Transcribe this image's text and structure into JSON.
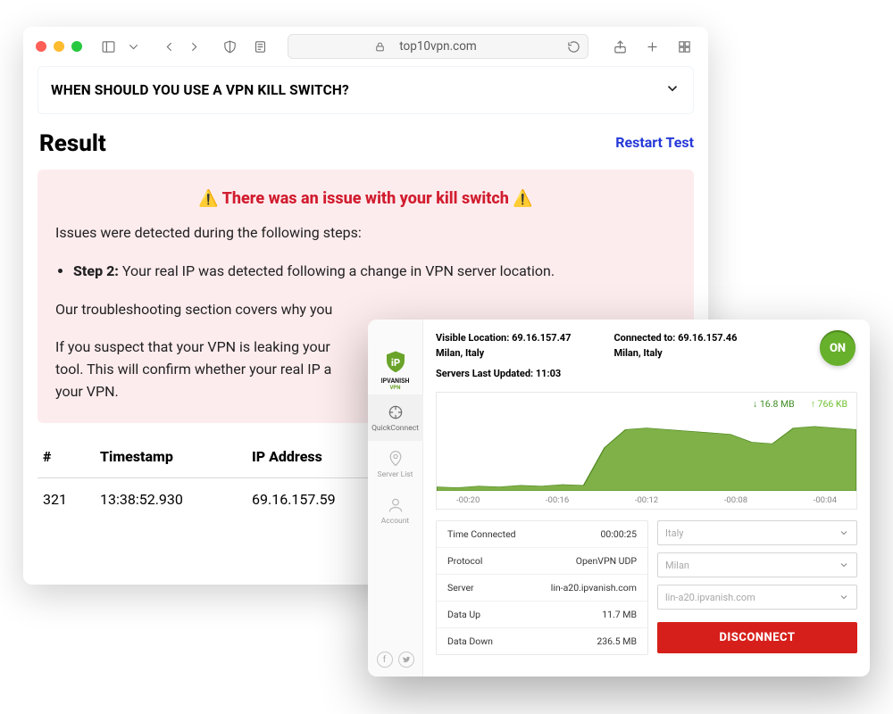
{
  "browser": {
    "domain": "top10vpn.com",
    "accordion_title": "WHEN SHOULD YOU USE A VPN KILL SWITCH?",
    "result_heading": "Result",
    "restart_label": "Restart Test",
    "alert_title_core": "There was an issue with your kill switch",
    "issues_intro": "Issues were detected during the following steps:",
    "step_label": "Step 2:",
    "step_text": "Your real IP was detected following a change in VPN server location.",
    "troubleshoot_trunc": "Our troubleshooting section covers why you",
    "leak_para_trunc": "If you suspect that your VPN is leaking your \ntool. This will confirm whether your real IP a\nyour VPN.",
    "table": {
      "headers": [
        "#",
        "Timestamp",
        "IP Address"
      ],
      "row": [
        "321",
        "13:38:52.930",
        "69.16.157.59"
      ]
    }
  },
  "app": {
    "brand": "IPVANISH",
    "brand_sub": "VPN",
    "nav": {
      "quickconnect": "QuickConnect",
      "serverlist": "Server List",
      "account": "Account"
    },
    "visible_location_label": "Visible Location:",
    "visible_location_ip": "69.16.157.47",
    "visible_location_city": "Milan, Italy",
    "servers_updated_label": "Servers Last Updated:",
    "servers_updated_time": "11:03",
    "connected_to_label": "Connected to:",
    "connected_to_ip": "69.16.157.46",
    "connected_to_city": "Milan, Italy",
    "on_label": "ON",
    "down_rate": "16.8 MB",
    "up_rate": "766 KB",
    "axis": [
      "-00:20",
      "-00:16",
      "-00:12",
      "-00:08",
      "-00:04"
    ],
    "stats": {
      "time_connected_label": "Time Connected",
      "time_connected": "00:00:25",
      "protocol_label": "Protocol",
      "protocol": "OpenVPN UDP",
      "server_label": "Server",
      "server": "lin-a20.ipvanish.com",
      "data_up_label": "Data Up",
      "data_up": "11.7 MB",
      "data_down_label": "Data Down",
      "data_down": "236.5 MB"
    },
    "dd_country": "Italy",
    "dd_city": "Milan",
    "dd_server": "lin-a20.ipvanish.com",
    "disconnect_label": "DISCONNECT"
  },
  "chart_data": {
    "type": "area",
    "x": [
      -20,
      -19,
      -18,
      -17,
      -16,
      -15,
      -14,
      -13,
      -12,
      -11,
      -10,
      -9,
      -8,
      -7,
      -6,
      -5,
      -4,
      -3,
      -2,
      -1,
      0
    ],
    "series": [
      {
        "name": "down",
        "values": [
          5,
          4,
          6,
          5,
          7,
          6,
          8,
          7,
          55,
          78,
          80,
          78,
          76,
          74,
          72,
          62,
          60,
          80,
          82,
          80,
          78
        ]
      }
    ],
    "ylim": [
      0,
      100
    ],
    "xlabels": [
      "-00:20",
      "-00:16",
      "-00:12",
      "-00:08",
      "-00:04"
    ],
    "legend": {
      "down": "16.8 MB",
      "up": "766 KB"
    }
  }
}
